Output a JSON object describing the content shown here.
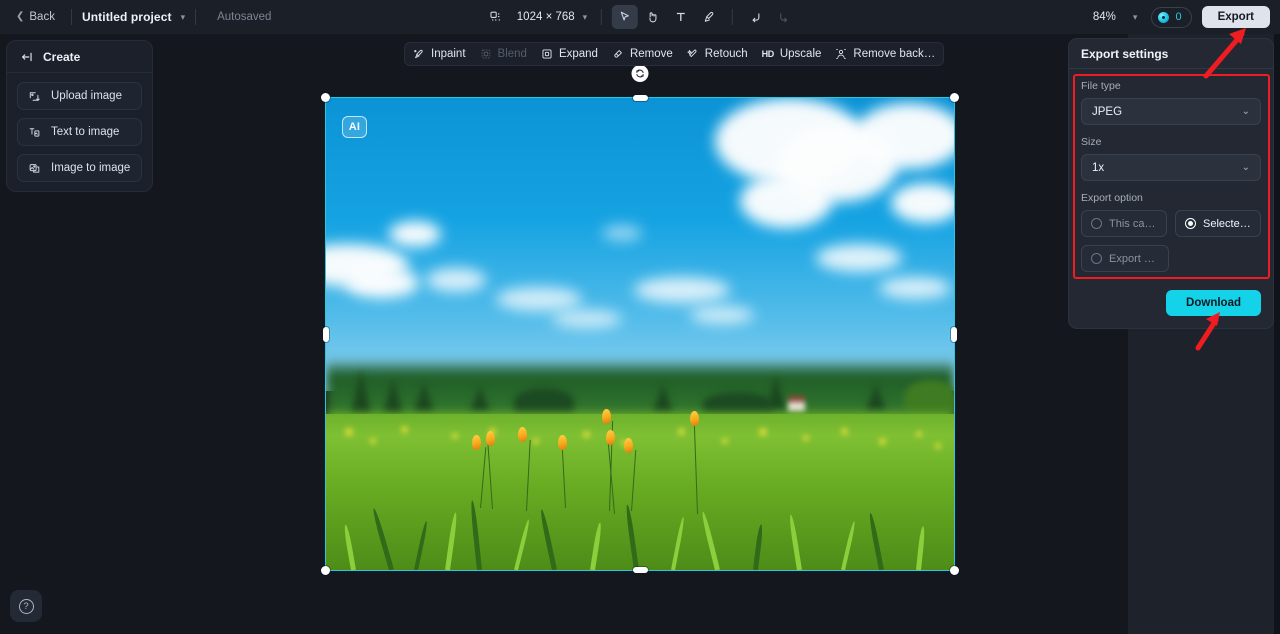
{
  "topbar": {
    "back_label": "Back",
    "project_title": "Untitled project",
    "autosaved_label": "Autosaved",
    "canvas_size": "1024 × 768",
    "zoom_level": "84%",
    "credits_count": "0",
    "export_label": "Export",
    "tools": [
      {
        "name": "layers-icon",
        "title": "Layers"
      },
      {
        "name": "select-tool",
        "title": "Select"
      },
      {
        "name": "hand-tool",
        "title": "Hand"
      },
      {
        "name": "text-tool",
        "title": "Text"
      },
      {
        "name": "brush-tool",
        "title": "Brush"
      },
      {
        "name": "undo-button",
        "title": "Undo"
      },
      {
        "name": "redo-button",
        "title": "Redo"
      }
    ]
  },
  "create_panel": {
    "title": "Create",
    "items": [
      {
        "label": "Upload image",
        "icon": "upload-image-icon"
      },
      {
        "label": "Text to image",
        "icon": "text-to-image-icon"
      },
      {
        "label": "Image to image",
        "icon": "image-to-image-icon"
      }
    ]
  },
  "action_toolbar": {
    "items": [
      {
        "label": "Inpaint",
        "icon": "inpaint-icon",
        "disabled": false
      },
      {
        "label": "Blend",
        "icon": "blend-icon",
        "disabled": true
      },
      {
        "label": "Expand",
        "icon": "expand-icon",
        "disabled": false
      },
      {
        "label": "Remove",
        "icon": "remove-icon",
        "disabled": false
      },
      {
        "label": "Retouch",
        "icon": "retouch-icon",
        "disabled": false
      },
      {
        "label": "Upscale",
        "icon": "hd-icon",
        "disabled": false
      },
      {
        "label": "Remove back…",
        "icon": "remove-background-icon",
        "disabled": false
      }
    ]
  },
  "canvas": {
    "ai_badge": "AI",
    "image_description": "Blurred sunny meadow with yellow tulip buds, green grass, treeline and blue sky with white clouds"
  },
  "export_settings": {
    "title": "Export settings",
    "file_type_label": "File type",
    "file_type_value": "JPEG",
    "size_label": "Size",
    "size_value": "1x",
    "export_option_label": "Export option",
    "options": [
      {
        "label": "This canvas",
        "selected": false
      },
      {
        "label": "Selected l…",
        "selected": true
      },
      {
        "label": "Export all …",
        "selected": false
      }
    ],
    "download_label": "Download"
  },
  "help": {
    "icon": "help-icon",
    "label": "?"
  },
  "colors": {
    "accent_cyan": "#14d3e8",
    "selection_cyan": "#25c9e0",
    "annotation_red": "#ef1d22",
    "panel_bg": "#232833",
    "topbar_bg": "#1b1f28"
  }
}
